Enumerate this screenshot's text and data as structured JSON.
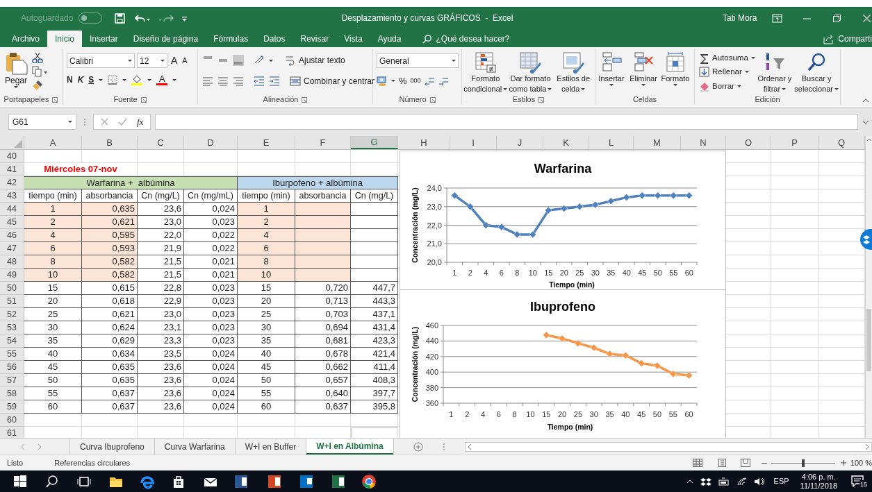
{
  "window": {
    "autosave_label": "Autoguardado",
    "autosave_on": false,
    "title": "Desplazamiento y curvas GRÁFICOS  -  Excel",
    "user": "Tati Mora"
  },
  "menu_tabs": [
    {
      "label": "Archivo",
      "selected": false
    },
    {
      "label": "Inicio",
      "selected": true
    },
    {
      "label": "Insertar",
      "selected": false
    },
    {
      "label": "Diseño de página",
      "selected": false
    },
    {
      "label": "Fórmulas",
      "selected": false
    },
    {
      "label": "Datos",
      "selected": false
    },
    {
      "label": "Revisar",
      "selected": false
    },
    {
      "label": "Vista",
      "selected": false
    },
    {
      "label": "Ayuda",
      "selected": false
    }
  ],
  "tell_me": "¿Qué desea hacer?",
  "share": "Comparti",
  "ribbon": {
    "clipboard": {
      "paste": "Pegar",
      "label": "Portapapeles"
    },
    "font": {
      "name": "Calibri",
      "size": "12",
      "grow": "A",
      "shrink": "A",
      "bold": "N",
      "italic": "K",
      "underline": "S",
      "font_color": "A",
      "label": "Fuente"
    },
    "alignment": {
      "wrap": "Ajustar texto",
      "merge": "Combinar y centrar",
      "label": "Alineación"
    },
    "number": {
      "format": "General",
      "percent": "%",
      "thousands": "000",
      "label": "Número"
    },
    "styles": {
      "buttons": [
        [
          "Formato",
          "condicional"
        ],
        [
          "Dar formato",
          "como tabla"
        ],
        [
          "Estilos de",
          "celda"
        ]
      ],
      "label": "Estilos"
    },
    "cells": {
      "buttons": [
        "Insertar",
        "Eliminar",
        "Formato"
      ],
      "label": "Celdas"
    },
    "editing": {
      "autosum": "Autosuma",
      "fill": "Rellenar",
      "clear": "Borrar",
      "sort": [
        "Ordenar y",
        "filtrar"
      ],
      "find": [
        "Buscar y",
        "seleccionar"
      ],
      "label": "Edición"
    }
  },
  "formula_bar": {
    "name_box": "G61",
    "fx": "fx"
  },
  "sheet": {
    "columns": [
      {
        "label": "A",
        "selected": false
      },
      {
        "label": "B",
        "selected": false
      },
      {
        "label": "C",
        "selected": false
      },
      {
        "label": "D",
        "selected": false
      },
      {
        "label": "E",
        "selected": false
      },
      {
        "label": "F",
        "selected": false
      },
      {
        "label": "G",
        "selected": true
      },
      {
        "label": "H",
        "selected": false
      },
      {
        "label": "I",
        "selected": false
      },
      {
        "label": "J",
        "selected": false
      },
      {
        "label": "K",
        "selected": false
      },
      {
        "label": "L",
        "selected": false
      },
      {
        "label": "M",
        "selected": false
      },
      {
        "label": "N",
        "selected": false
      },
      {
        "label": "O",
        "selected": false
      },
      {
        "label": "P",
        "selected": false
      },
      {
        "label": "Q",
        "selected": false
      }
    ],
    "rows": [
      {
        "number": "40",
        "kind": "empty"
      },
      {
        "number": "41",
        "kind": "note",
        "text": "Miércoles 07-nov"
      },
      {
        "number": "42",
        "kind": "group",
        "cells": [
          "Warfarina +  albúmina",
          "Iburpofeno + albúmina"
        ]
      },
      {
        "number": "43",
        "kind": "header",
        "cells": [
          "tiempo (min)",
          "absorbancia",
          "Cn (mg/L)",
          "Cn (mg/mL)",
          "tiempo (min)",
          "absorbancia",
          "Cn (mg/L)"
        ]
      },
      {
        "number": "44",
        "kind": "data",
        "shaded": true,
        "cells": [
          "1",
          "0,635",
          "23,6",
          "0,024",
          "1"
        ]
      },
      {
        "number": "45",
        "kind": "data",
        "shaded": true,
        "cells": [
          "2",
          "0,621",
          "23,0",
          "0,023",
          "2"
        ]
      },
      {
        "number": "46",
        "kind": "data",
        "shaded": true,
        "cells": [
          "4",
          "0,595",
          "22,0",
          "0,022",
          "4"
        ]
      },
      {
        "number": "47",
        "kind": "data",
        "shaded": true,
        "cells": [
          "6",
          "0,593",
          "21,9",
          "0,022",
          "6"
        ]
      },
      {
        "number": "48",
        "kind": "data",
        "shaded": true,
        "cells": [
          "8",
          "0,582",
          "21,5",
          "0,021",
          "8"
        ]
      },
      {
        "number": "49",
        "kind": "data",
        "shaded": true,
        "cells": [
          "10",
          "0,582",
          "21,5",
          "0,021",
          "10"
        ]
      },
      {
        "number": "50",
        "kind": "data",
        "shaded": false,
        "cells": [
          "15",
          "0,615",
          "22,8",
          "0,023",
          "15",
          "0,720",
          "447,7"
        ]
      },
      {
        "number": "51",
        "kind": "data",
        "shaded": false,
        "cells": [
          "20",
          "0,618",
          "22,9",
          "0,023",
          "20",
          "0,713",
          "443,3"
        ]
      },
      {
        "number": "52",
        "kind": "data",
        "shaded": false,
        "cells": [
          "25",
          "0,621",
          "23,0",
          "0,023",
          "25",
          "0,703",
          "437,1"
        ]
      },
      {
        "number": "53",
        "kind": "data",
        "shaded": false,
        "cells": [
          "30",
          "0,624",
          "23,1",
          "0,023",
          "30",
          "0,694",
          "431,4"
        ]
      },
      {
        "number": "54",
        "kind": "data",
        "shaded": false,
        "cells": [
          "35",
          "0,629",
          "23,3",
          "0,023",
          "35",
          "0,681",
          "423,3"
        ]
      },
      {
        "number": "55",
        "kind": "data",
        "shaded": false,
        "cells": [
          "40",
          "0,634",
          "23,5",
          "0,024",
          "40",
          "0,678",
          "421,4"
        ]
      },
      {
        "number": "56",
        "kind": "data",
        "shaded": false,
        "cells": [
          "45",
          "0,635",
          "23,6",
          "0,024",
          "45",
          "0,662",
          "411,4"
        ]
      },
      {
        "number": "57",
        "kind": "data",
        "shaded": false,
        "cells": [
          "50",
          "0,635",
          "23,6",
          "0,024",
          "50",
          "0,657",
          "408,3"
        ]
      },
      {
        "number": "58",
        "kind": "data",
        "shaded": false,
        "cells": [
          "55",
          "0,637",
          "23,6",
          "0,024",
          "55",
          "0,640",
          "397,7"
        ]
      },
      {
        "number": "59",
        "kind": "data",
        "shaded": false,
        "cells": [
          "60",
          "0,637",
          "23,6",
          "0,024",
          "60",
          "0,637",
          "395,8"
        ]
      },
      {
        "number": "60",
        "kind": "empty"
      },
      {
        "number": "61",
        "kind": "empty"
      }
    ],
    "charts": [
      {
        "chart_data": {
          "type": "line",
          "title": "Warfarina",
          "xlabel": "Tiempo (min)",
          "ylabel": "Concentración (mg/L)",
          "categories": [
            "1",
            "2",
            "4",
            "6",
            "8",
            "10",
            "15",
            "20",
            "25",
            "30",
            "35",
            "40",
            "45",
            "50",
            "55",
            "60"
          ],
          "grid": true,
          "series": [
            {
              "color": "#4f81bd",
              "marker": "diamond",
              "values": [
                23.6,
                23.0,
                22.0,
                21.9,
                21.5,
                21.5,
                22.8,
                22.9,
                23.0,
                23.1,
                23.3,
                23.5,
                23.6,
                23.6,
                23.6,
                23.6
              ]
            }
          ],
          "ylim": [
            20,
            24
          ],
          "yticks": [
            {
              "value": 20,
              "label": "20,0"
            },
            {
              "value": 21,
              "label": "21,0"
            },
            {
              "value": 22,
              "label": "22,0"
            },
            {
              "value": 23,
              "label": "23,0"
            },
            {
              "value": 24,
              "label": "24,0"
            }
          ]
        }
      },
      {
        "chart_data": {
          "type": "line",
          "title": "Ibuprofeno",
          "xlabel": "Tiempo (min)",
          "ylabel": "Concentración (mg/L)",
          "categories": [
            "1",
            "2",
            "4",
            "6",
            "8",
            "10",
            "15",
            "20",
            "25",
            "30",
            "35",
            "40",
            "45",
            "50",
            "55",
            "60"
          ],
          "grid": true,
          "series": [
            {
              "color": "#f79646",
              "marker": "diamond",
              "values": [
                null,
                null,
                null,
                null,
                null,
                null,
                447.7,
                443.3,
                437.1,
                431.4,
                423.3,
                421.4,
                411.4,
                408.3,
                397.7,
                395.8
              ]
            }
          ],
          "ylim": [
            360,
            460
          ],
          "yticks": [
            360,
            380,
            400,
            420,
            440,
            460
          ]
        }
      }
    ]
  },
  "sheet_tabs": [
    {
      "label": "Curva Ibuprofeno",
      "selected": false
    },
    {
      "label": "Curva Warfarina",
      "selected": false
    },
    {
      "label": "W+I en Buffer",
      "selected": false
    },
    {
      "label": "W+I en Albúmina",
      "selected": true
    }
  ],
  "status_bar": {
    "state": "Listo",
    "note": "Referencias circulares",
    "zoom": "100 %",
    "zoom_slider": {
      "level": 0.5
    }
  },
  "taskbar": {
    "language": "ESP",
    "time": "4:06 p. m.",
    "date": "11/11/2018",
    "notifications": "15"
  }
}
